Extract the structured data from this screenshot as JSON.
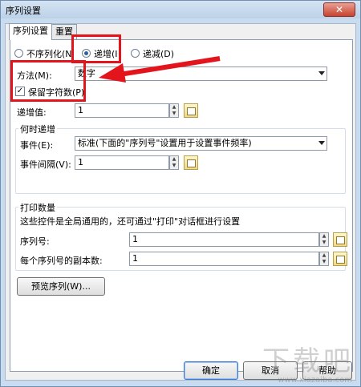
{
  "window": {
    "title": "序列设置",
    "close_glyph": "✕"
  },
  "tabs": [
    {
      "label": "序列设置",
      "active": true
    },
    {
      "label": "重置",
      "active": false
    }
  ],
  "radios": {
    "none": "不序列化(N",
    "inc": "递增(I",
    "dec": "递减(D)",
    "selected": "inc"
  },
  "method": {
    "label": "方法(M):",
    "value": "数字"
  },
  "keep_chars": {
    "label": "保留字符数(P)",
    "checked": true
  },
  "increment": {
    "label": "递增值:",
    "value": "1"
  },
  "when_group": {
    "title": "何时递增",
    "event_label": "事件(E):",
    "event_value": "标准(下面的\"序列号\"设置用于设置事件频率)",
    "interval_label": "事件间隔(V):",
    "interval_value": "1"
  },
  "print_group": {
    "title": "打印数量",
    "desc": "这些控件是全局通用的，还可通过\"打印\"对话框进行设置",
    "serial_label": "序列号:",
    "serial_value": "1",
    "copies_label": "每个序列号的副本数:",
    "copies_value": "1"
  },
  "preview_button": "预览序列(W)...",
  "buttons": {
    "ok": "确定",
    "cancel": "取消",
    "help": "帮助"
  },
  "watermark": {
    "main": "下载吧",
    "sub": "www.xiazaiba.com"
  },
  "annotation_color": "#e3141b"
}
